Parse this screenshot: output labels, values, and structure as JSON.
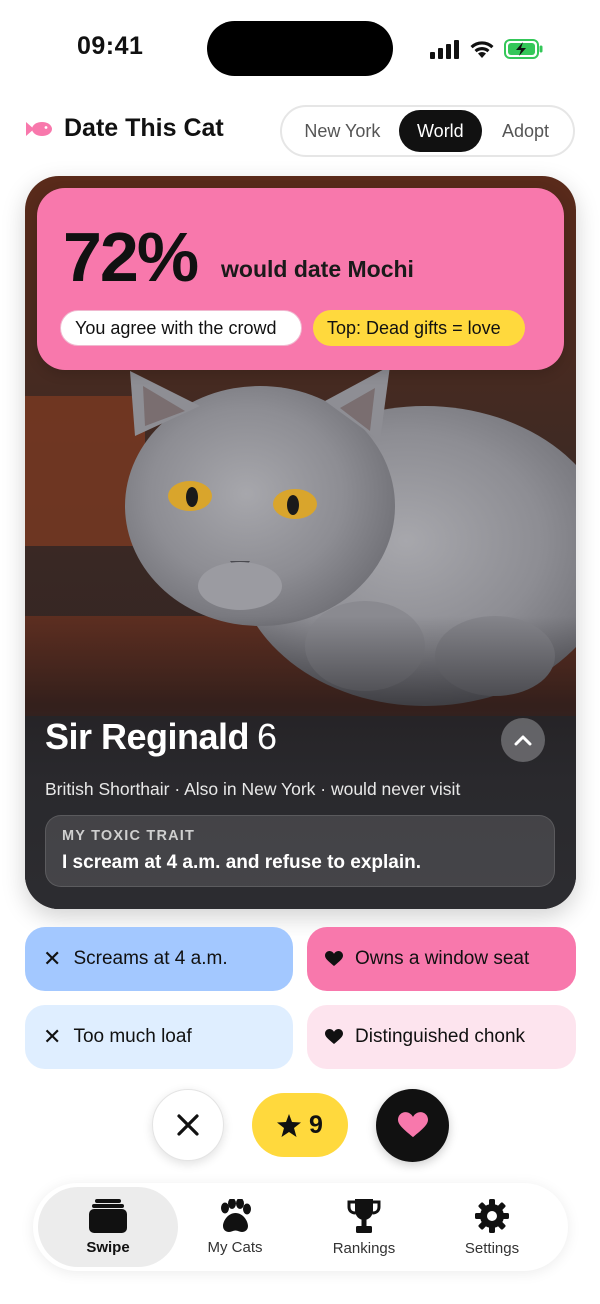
{
  "status_bar": {
    "time": "09:41"
  },
  "header": {
    "app_title": "Date This Cat",
    "segments": [
      {
        "label": "New York",
        "active": false
      },
      {
        "label": "World",
        "active": true
      },
      {
        "label": "Adopt",
        "active": false
      }
    ]
  },
  "card": {
    "stat": {
      "percent": "72%",
      "label": "would date Mochi",
      "agree_pill": "You agree with the crowd",
      "top_pill": "Top: Dead gifts = love"
    },
    "cat": {
      "name": "Sir Reginald",
      "age": "6",
      "meta": "British Shorthair · Also in New York · would never visit",
      "trait_label": "MY TOXIC TRAIT",
      "trait_text": "I scream at 4 a.m. and refuse to explain."
    }
  },
  "tags": [
    {
      "label": "Screams at 4 a.m.",
      "kind": "dislike",
      "color": "#a3c8ff"
    },
    {
      "label": "Owns a window seat",
      "kind": "like",
      "color": "#f878ac"
    },
    {
      "label": "Too much loaf",
      "kind": "dislike",
      "color": "#dfeeff"
    },
    {
      "label": "Distinguished chonk",
      "kind": "like",
      "color": "#fde4ee"
    }
  ],
  "actions": {
    "superlike_count": "9"
  },
  "tabbar": {
    "items": [
      {
        "label": "Swipe",
        "icon": "cards-icon",
        "active": true
      },
      {
        "label": "My Cats",
        "icon": "paw-icon",
        "active": false
      },
      {
        "label": "Rankings",
        "icon": "trophy-icon",
        "active": false
      },
      {
        "label": "Settings",
        "icon": "gear-icon",
        "active": false
      }
    ]
  },
  "colors": {
    "accent_pink": "#f878ac",
    "accent_yellow": "#ffd93d",
    "dark": "#111111"
  }
}
